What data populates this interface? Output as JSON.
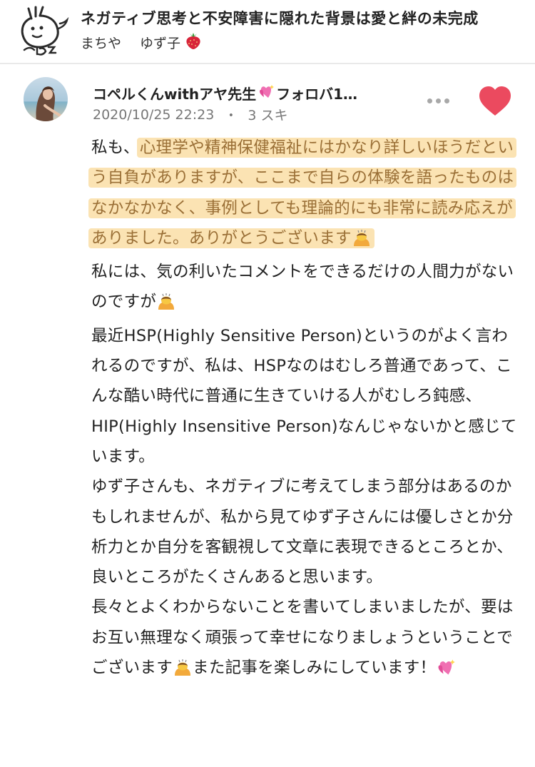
{
  "header": {
    "article_title": "ネガティブ思考と不安障害に隠れた背景は愛と絆の未完成",
    "author_prefix": "まちや",
    "author_name": "ゆず子",
    "author_emoji": "strawberry-icon"
  },
  "comment": {
    "commenter_name": "コペルくんwithアヤ先生",
    "commenter_name_suffix": "フォロバ1…",
    "name_emoji": "sparkling-heart-icon",
    "date": "2020/10/25 22:23",
    "separator": "・",
    "likes": "3 スキ",
    "more_icon": "more-dots-icon",
    "like_icon": "heart-icon",
    "like_color": "#eb4a5f",
    "highlight_color": "#f9da9a",
    "paragraphs": [
      {
        "pre": "私も、",
        "highlight": "心理学や精神保健福祉にはかなり詳しいほうだという自負がありますが、ここまで自らの体験を語ったものはなかなかなく、事例としても理論的にも非常に読み応えがありました。ありがとうございます",
        "emoji": "bowing-person-icon"
      },
      {
        "text": "私には、気の利いたコメントをできるだけの人間力がないのですが",
        "emoji": "bowing-person-icon"
      },
      {
        "text": "最近HSP(Highly Sensitive Person)というのがよく言われるのですが、私は、HSPなのはむしろ普通であって、こんな酷い時代に普通に生きていける人がむしろ鈍感、HIP(Highly Insensitive Person)なんじゃないかと感じています。"
      },
      {
        "text": "ゆず子さんも、ネガティブに考えてしまう部分はあるのかもしれませんが、私から見てゆず子さんには優しさとか分析力とか自分を客観視して文章に表現できるところとか、良いところがたくさんあると思います。"
      },
      {
        "text": "長々とよくわからないことを書いてしまいましたが、要はお互い無理なく頑張って幸せになりましょうということでございます",
        "emoji": "bowing-person-icon",
        "text_after": "また記事を楽しみにしています！",
        "emoji_end": "sparkling-heart-icon"
      }
    ]
  }
}
